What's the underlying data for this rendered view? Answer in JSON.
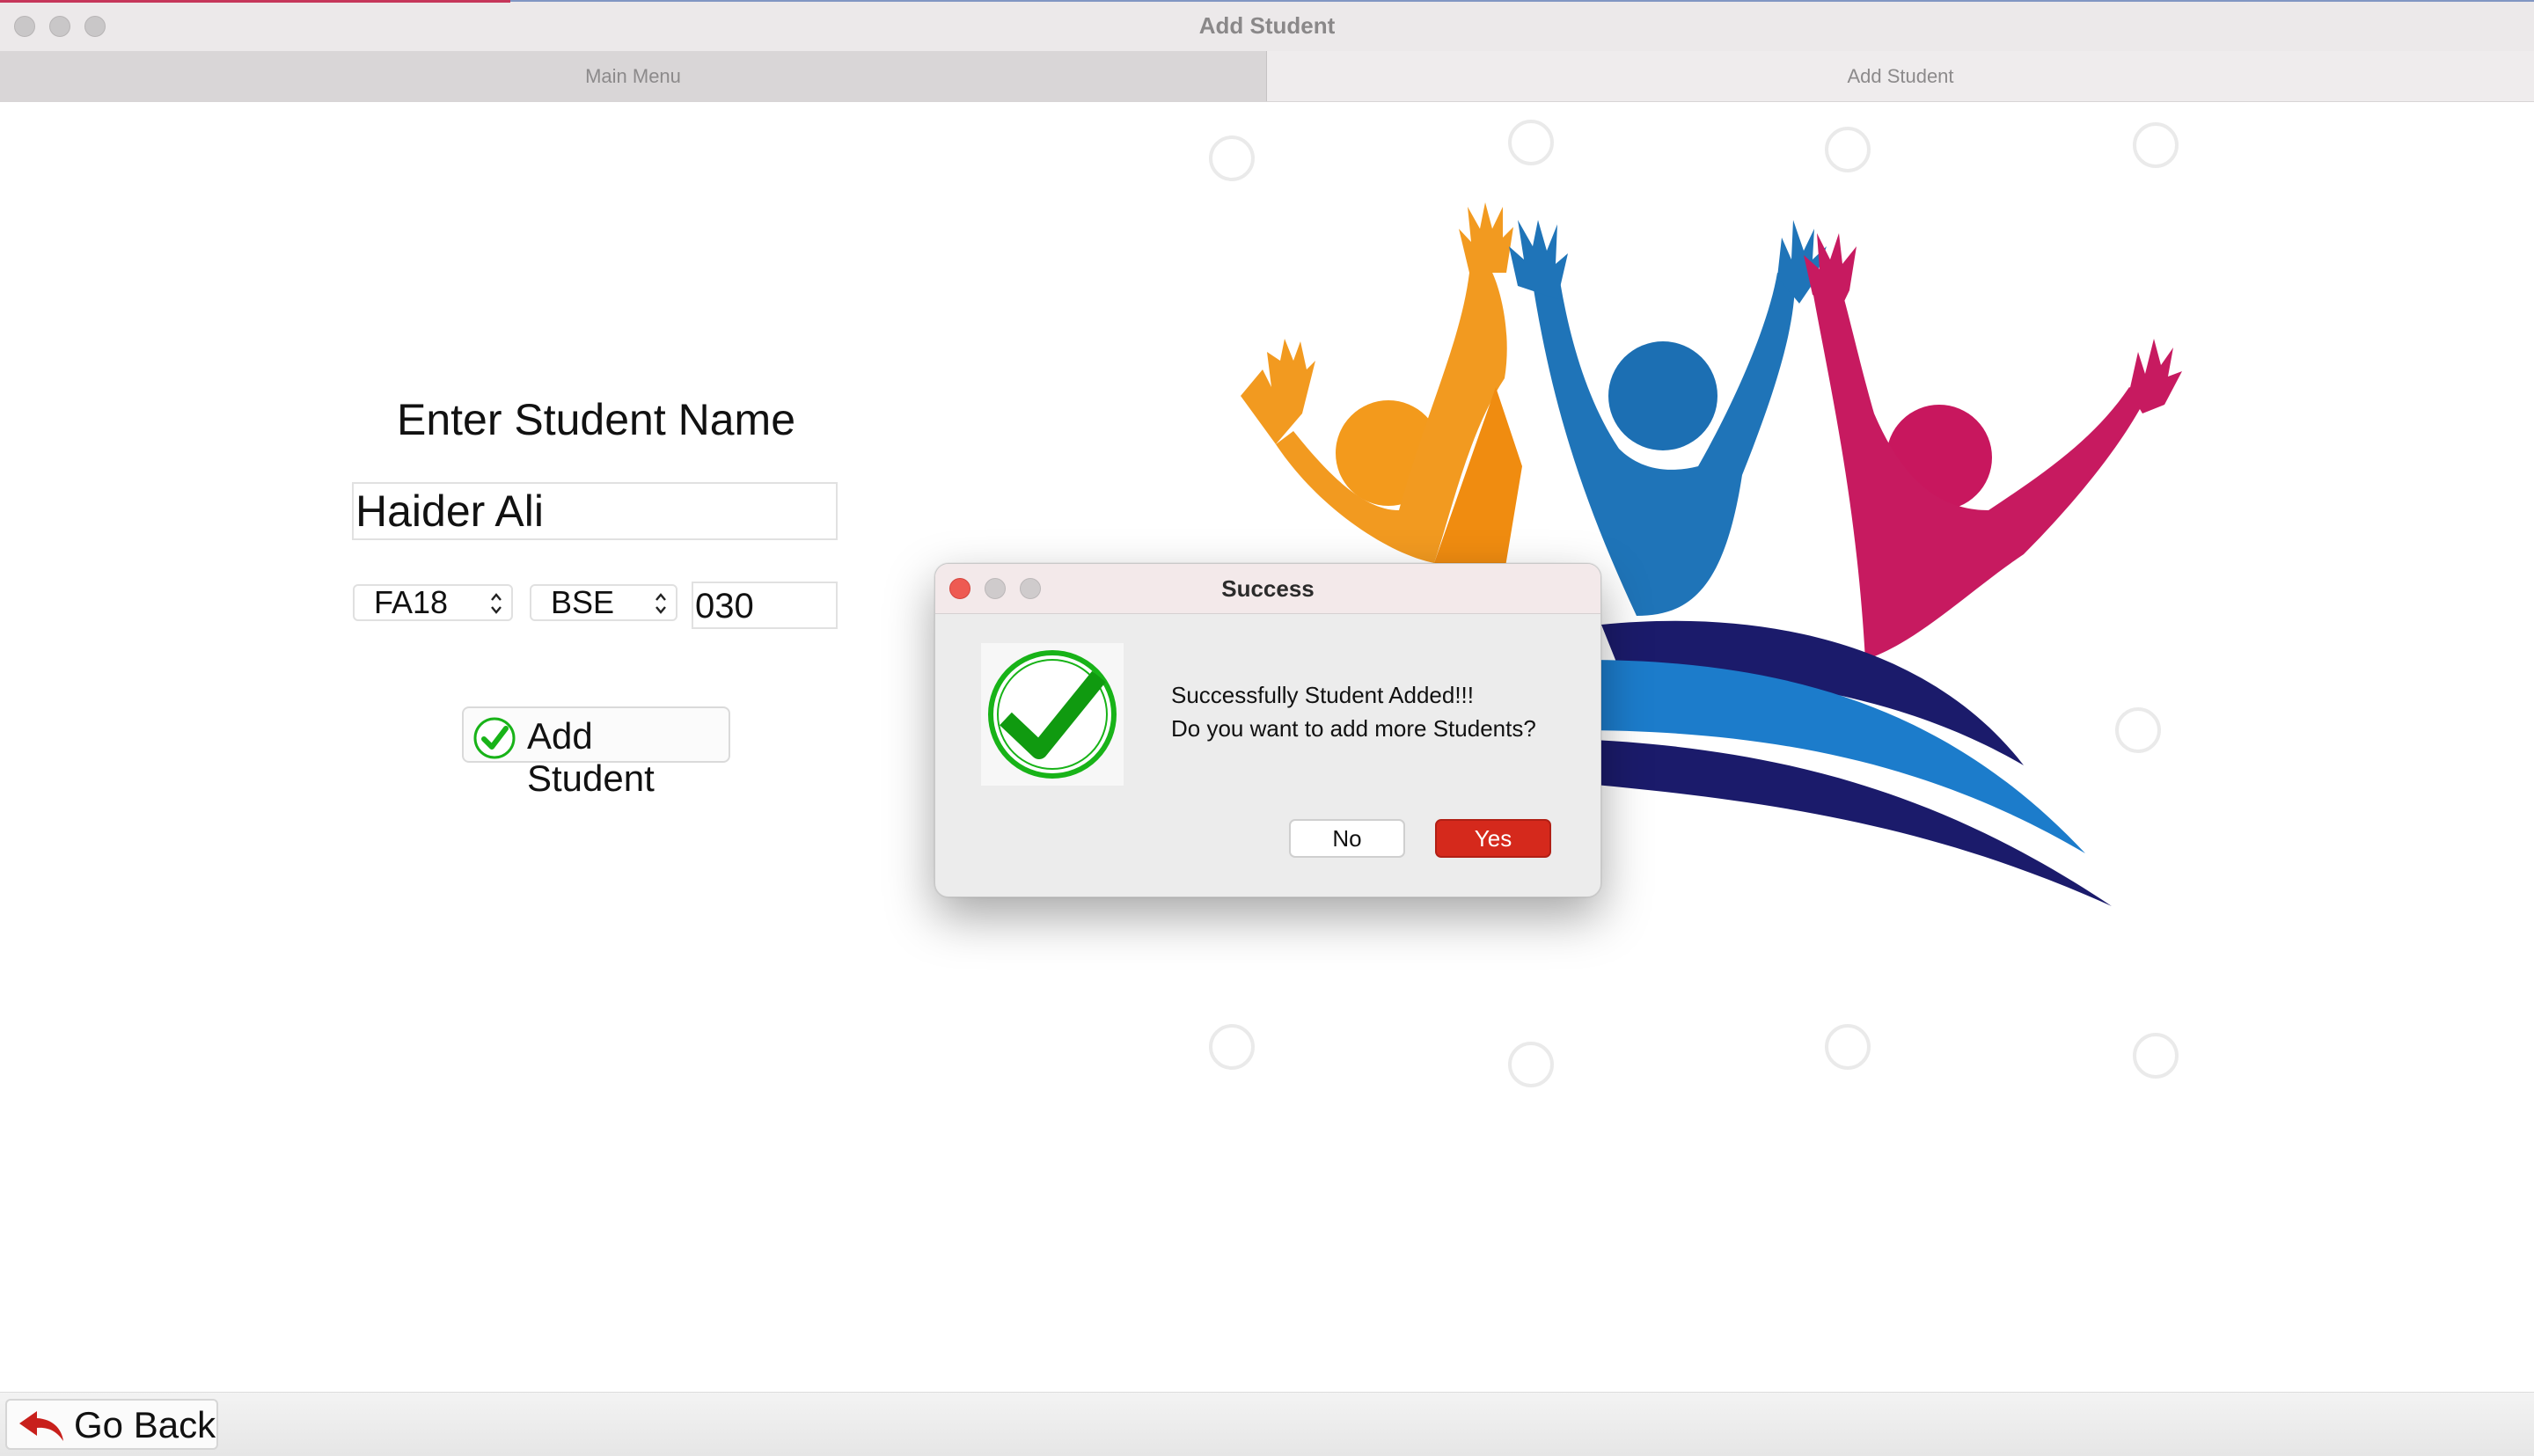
{
  "window": {
    "title": "Add Student"
  },
  "tabs": [
    {
      "label": "Main Menu"
    },
    {
      "label": "Add Student"
    }
  ],
  "form": {
    "heading": "Enter Student Name",
    "name_value": "Haider Ali",
    "session_select": "FA18",
    "program_select": "BSE",
    "roll_value": "030",
    "add_button_label": "Add Student"
  },
  "footer": {
    "go_back_label": "Go Back"
  },
  "dialog": {
    "title": "Success",
    "message_line1": "Successfully Student Added!!!",
    "message_line2": "Do you want to add more Students?",
    "no_label": "No",
    "yes_label": "Yes"
  },
  "colors": {
    "accent_red": "#d5291c",
    "check_green": "#18b318",
    "logo_orange": "#f39a1c",
    "logo_blue": "#1c6fb3",
    "logo_magenta": "#c8175e",
    "logo_navy": "#1b1b6b"
  },
  "icons": [
    "check-icon",
    "back-arrow-icon",
    "select-arrows-icon"
  ]
}
